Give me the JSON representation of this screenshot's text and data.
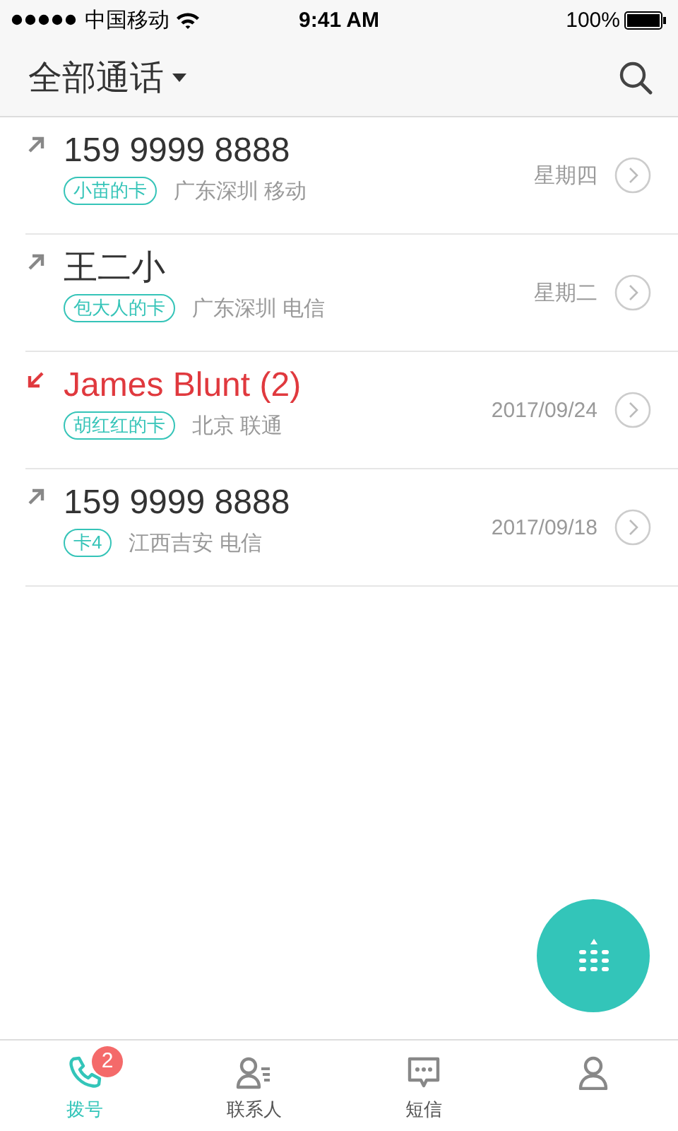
{
  "status_bar": {
    "carrier": "中国移动",
    "time": "9:41 AM",
    "battery": "100%"
  },
  "header": {
    "title": "全部通话"
  },
  "calls": [
    {
      "kind": "outgoing",
      "name": "159 9999 8888",
      "card": "小苗的卡",
      "location": "广东深圳 移动",
      "date": "星期四"
    },
    {
      "kind": "outgoing",
      "name": "王二小",
      "card": "包大人的卡",
      "location": "广东深圳 电信",
      "date": "星期二"
    },
    {
      "kind": "missed",
      "name": "James Blunt (2)",
      "card": "胡红红的卡",
      "location": "北京 联通",
      "date": "2017/09/24"
    },
    {
      "kind": "outgoing",
      "name": "159 9999 8888",
      "card": "卡4",
      "location": "江西吉安 电信",
      "date": "2017/09/18"
    }
  ],
  "tab_bar": [
    {
      "kind": "phone",
      "label": "拨号",
      "badge": "2",
      "selected": true
    },
    {
      "kind": "contacts",
      "label": "联系人",
      "selected": false
    },
    {
      "kind": "sms",
      "label": "短信",
      "selected": false
    },
    {
      "kind": "person",
      "selected": false
    }
  ]
}
